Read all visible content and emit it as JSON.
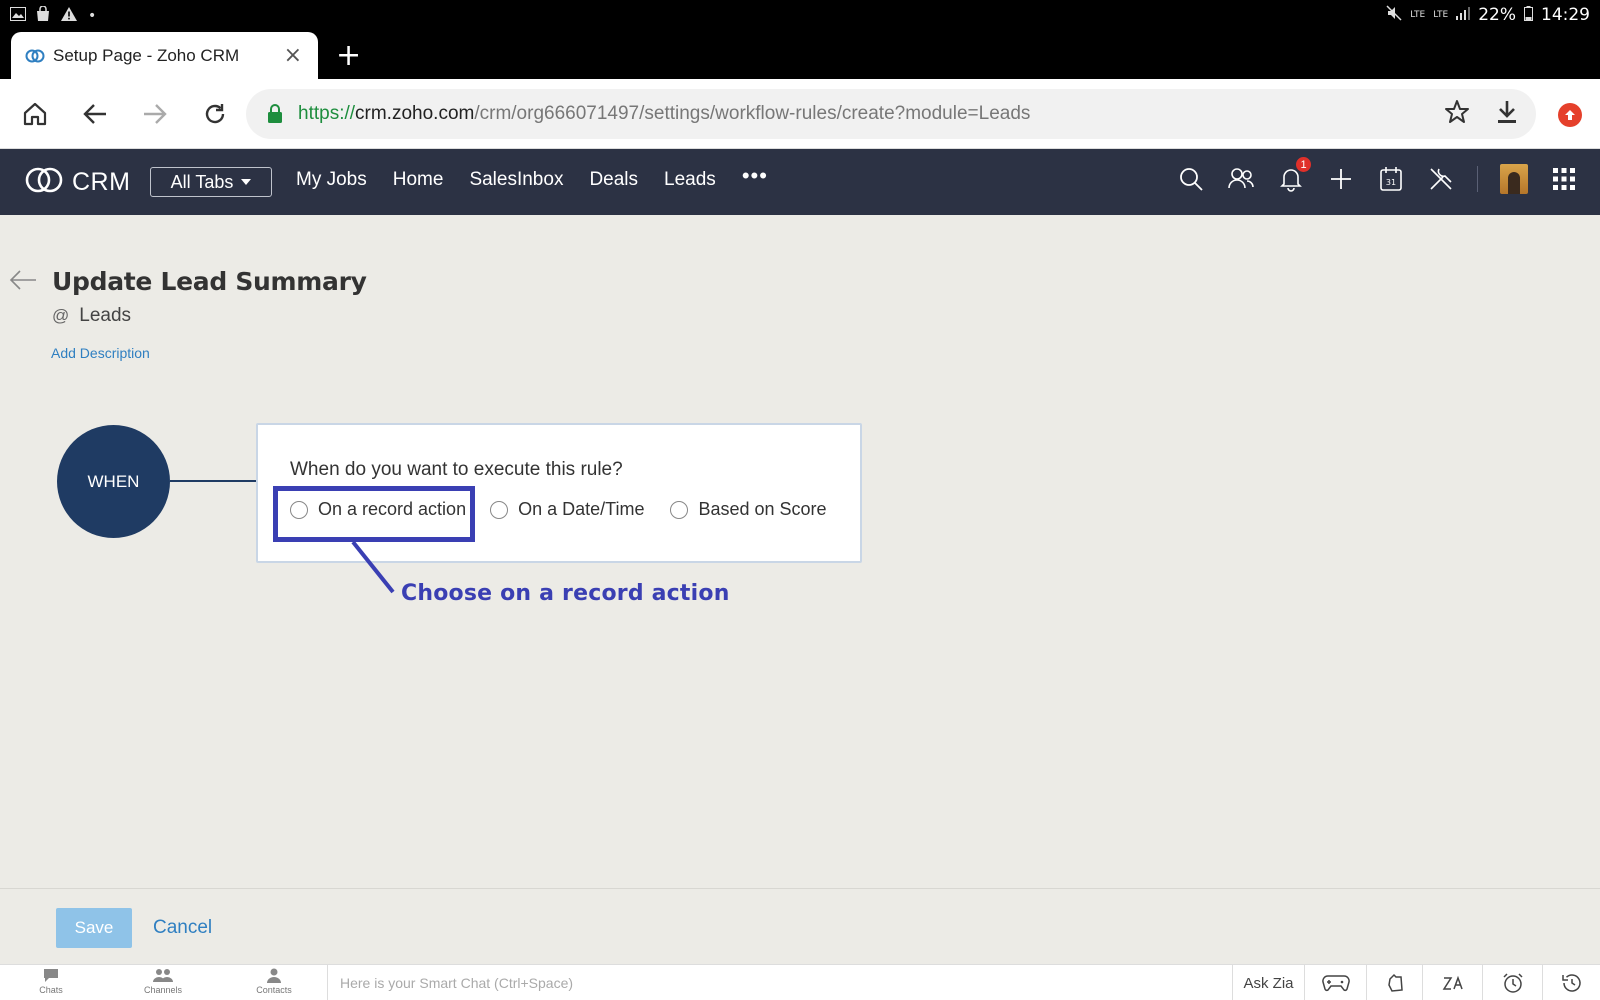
{
  "status_bar": {
    "battery": "22%",
    "time": "14:29",
    "net_1": "LTE",
    "net_2": "LTE"
  },
  "browser": {
    "tab_title": "Setup Page - Zoho CRM",
    "url_scheme": "https://",
    "url_host": "crm.zoho.com",
    "url_path": "/crm/org666071497/settings/workflow-rules/create?module=Leads"
  },
  "crm_header": {
    "logo_text": "CRM",
    "all_tabs_label": "All Tabs",
    "nav": [
      "My Jobs",
      "Home",
      "SalesInbox",
      "Deals",
      "Leads"
    ],
    "more": "•••",
    "notification_count": "1",
    "calendar_day": "31"
  },
  "page": {
    "title": "Update Lead Summary",
    "module_prefix": "@",
    "module": "Leads",
    "add_description": "Add Description"
  },
  "rule": {
    "when_label": "WHEN",
    "question": "When do you want to execute this rule?",
    "options": [
      "On a record action",
      "On a Date/Time",
      "Based on Score"
    ]
  },
  "annotation": {
    "callout": "Choose on a record action",
    "color": "#3a3fb3"
  },
  "footer": {
    "save_label": "Save",
    "cancel_label": "Cancel"
  },
  "chat_bar": {
    "tabs": [
      "Chats",
      "Channels",
      "Contacts"
    ],
    "placeholder": "Here is your Smart Chat (Ctrl+Space)",
    "ask_zia": "Ask Zia"
  },
  "colors": {
    "header_bg": "#2c3244",
    "when_circle": "#1f3b63",
    "link": "#2f7fc1",
    "save_disabled": "#8fc3e8"
  }
}
